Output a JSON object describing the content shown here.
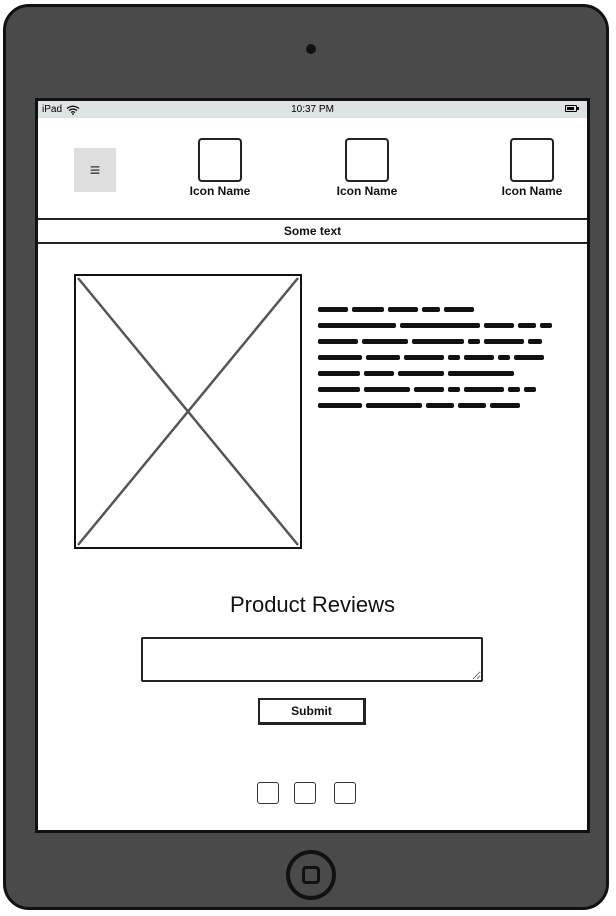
{
  "status_bar": {
    "device": "iPad",
    "time": "10:37 PM"
  },
  "header": {
    "menu_icon": "≡",
    "nav_items": [
      {
        "label": "Icon Name"
      },
      {
        "label": "Icon Name"
      },
      {
        "label": "Icon Name"
      }
    ]
  },
  "banner": {
    "text": "Some text"
  },
  "main": {
    "section_title": "Product Reviews",
    "review_input_value": "",
    "submit_label": "Submit"
  },
  "colors": {
    "device_body": "#4a4a4a",
    "status_bar": "#dde2e5",
    "menu_button": "#dedede"
  }
}
